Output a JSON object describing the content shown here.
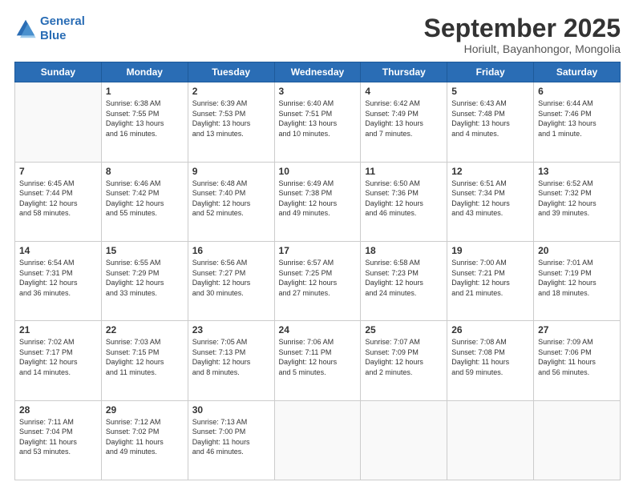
{
  "header": {
    "logo_line1": "General",
    "logo_line2": "Blue",
    "month": "September 2025",
    "location": "Horiult, Bayanhongor, Mongolia"
  },
  "days_of_week": [
    "Sunday",
    "Monday",
    "Tuesday",
    "Wednesday",
    "Thursday",
    "Friday",
    "Saturday"
  ],
  "weeks": [
    [
      {
        "day": "",
        "info": ""
      },
      {
        "day": "1",
        "info": "Sunrise: 6:38 AM\nSunset: 7:55 PM\nDaylight: 13 hours\nand 16 minutes."
      },
      {
        "day": "2",
        "info": "Sunrise: 6:39 AM\nSunset: 7:53 PM\nDaylight: 13 hours\nand 13 minutes."
      },
      {
        "day": "3",
        "info": "Sunrise: 6:40 AM\nSunset: 7:51 PM\nDaylight: 13 hours\nand 10 minutes."
      },
      {
        "day": "4",
        "info": "Sunrise: 6:42 AM\nSunset: 7:49 PM\nDaylight: 13 hours\nand 7 minutes."
      },
      {
        "day": "5",
        "info": "Sunrise: 6:43 AM\nSunset: 7:48 PM\nDaylight: 13 hours\nand 4 minutes."
      },
      {
        "day": "6",
        "info": "Sunrise: 6:44 AM\nSunset: 7:46 PM\nDaylight: 13 hours\nand 1 minute."
      }
    ],
    [
      {
        "day": "7",
        "info": "Sunrise: 6:45 AM\nSunset: 7:44 PM\nDaylight: 12 hours\nand 58 minutes."
      },
      {
        "day": "8",
        "info": "Sunrise: 6:46 AM\nSunset: 7:42 PM\nDaylight: 12 hours\nand 55 minutes."
      },
      {
        "day": "9",
        "info": "Sunrise: 6:48 AM\nSunset: 7:40 PM\nDaylight: 12 hours\nand 52 minutes."
      },
      {
        "day": "10",
        "info": "Sunrise: 6:49 AM\nSunset: 7:38 PM\nDaylight: 12 hours\nand 49 minutes."
      },
      {
        "day": "11",
        "info": "Sunrise: 6:50 AM\nSunset: 7:36 PM\nDaylight: 12 hours\nand 46 minutes."
      },
      {
        "day": "12",
        "info": "Sunrise: 6:51 AM\nSunset: 7:34 PM\nDaylight: 12 hours\nand 43 minutes."
      },
      {
        "day": "13",
        "info": "Sunrise: 6:52 AM\nSunset: 7:32 PM\nDaylight: 12 hours\nand 39 minutes."
      }
    ],
    [
      {
        "day": "14",
        "info": "Sunrise: 6:54 AM\nSunset: 7:31 PM\nDaylight: 12 hours\nand 36 minutes."
      },
      {
        "day": "15",
        "info": "Sunrise: 6:55 AM\nSunset: 7:29 PM\nDaylight: 12 hours\nand 33 minutes."
      },
      {
        "day": "16",
        "info": "Sunrise: 6:56 AM\nSunset: 7:27 PM\nDaylight: 12 hours\nand 30 minutes."
      },
      {
        "day": "17",
        "info": "Sunrise: 6:57 AM\nSunset: 7:25 PM\nDaylight: 12 hours\nand 27 minutes."
      },
      {
        "day": "18",
        "info": "Sunrise: 6:58 AM\nSunset: 7:23 PM\nDaylight: 12 hours\nand 24 minutes."
      },
      {
        "day": "19",
        "info": "Sunrise: 7:00 AM\nSunset: 7:21 PM\nDaylight: 12 hours\nand 21 minutes."
      },
      {
        "day": "20",
        "info": "Sunrise: 7:01 AM\nSunset: 7:19 PM\nDaylight: 12 hours\nand 18 minutes."
      }
    ],
    [
      {
        "day": "21",
        "info": "Sunrise: 7:02 AM\nSunset: 7:17 PM\nDaylight: 12 hours\nand 14 minutes."
      },
      {
        "day": "22",
        "info": "Sunrise: 7:03 AM\nSunset: 7:15 PM\nDaylight: 12 hours\nand 11 minutes."
      },
      {
        "day": "23",
        "info": "Sunrise: 7:05 AM\nSunset: 7:13 PM\nDaylight: 12 hours\nand 8 minutes."
      },
      {
        "day": "24",
        "info": "Sunrise: 7:06 AM\nSunset: 7:11 PM\nDaylight: 12 hours\nand 5 minutes."
      },
      {
        "day": "25",
        "info": "Sunrise: 7:07 AM\nSunset: 7:09 PM\nDaylight: 12 hours\nand 2 minutes."
      },
      {
        "day": "26",
        "info": "Sunrise: 7:08 AM\nSunset: 7:08 PM\nDaylight: 11 hours\nand 59 minutes."
      },
      {
        "day": "27",
        "info": "Sunrise: 7:09 AM\nSunset: 7:06 PM\nDaylight: 11 hours\nand 56 minutes."
      }
    ],
    [
      {
        "day": "28",
        "info": "Sunrise: 7:11 AM\nSunset: 7:04 PM\nDaylight: 11 hours\nand 53 minutes."
      },
      {
        "day": "29",
        "info": "Sunrise: 7:12 AM\nSunset: 7:02 PM\nDaylight: 11 hours\nand 49 minutes."
      },
      {
        "day": "30",
        "info": "Sunrise: 7:13 AM\nSunset: 7:00 PM\nDaylight: 11 hours\nand 46 minutes."
      },
      {
        "day": "",
        "info": ""
      },
      {
        "day": "",
        "info": ""
      },
      {
        "day": "",
        "info": ""
      },
      {
        "day": "",
        "info": ""
      }
    ]
  ]
}
